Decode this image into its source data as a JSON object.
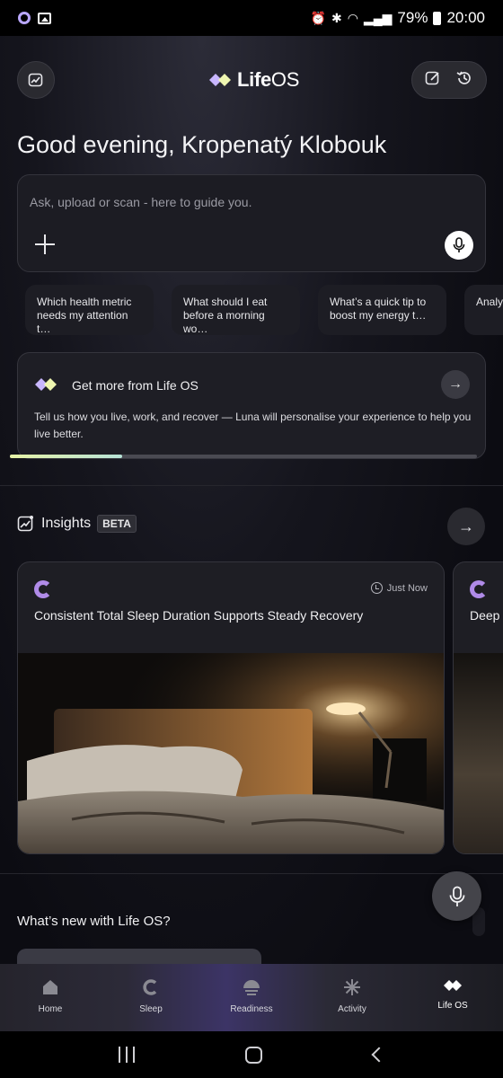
{
  "status_bar": {
    "battery": "79%",
    "time": "20:00"
  },
  "header": {
    "logo_bold": "Life",
    "logo_light": "OS"
  },
  "greeting": "Good evening, Kropenatý Klobouk",
  "ask": {
    "placeholder": "Ask, upload or scan - here to guide you."
  },
  "suggestions": [
    "Which health metric needs my attention t…",
    "What should I eat before a morning wo…",
    "What’s a quick tip to boost my energy t…",
    "Analy worko"
  ],
  "promo": {
    "title": "Get more from Life OS",
    "description": "Tell us how you live, work, and recover — Luna will personalise your experience to help you live better.",
    "progress": 0.24
  },
  "insights": {
    "title": "Insights",
    "badge": "BETA",
    "cards": [
      {
        "time": "Just Now",
        "title": "Consistent Total Sleep Duration Supports Steady Recovery"
      },
      {
        "time": "",
        "title": "Deep S"
      }
    ]
  },
  "whats_new": {
    "title": "What’s new with Life OS?"
  },
  "bottom_nav": [
    {
      "label": "Home",
      "icon": "home-icon"
    },
    {
      "label": "Sleep",
      "icon": "sleep-icon"
    },
    {
      "label": "Readiness",
      "icon": "readiness-icon"
    },
    {
      "label": "Activity",
      "icon": "activity-icon"
    },
    {
      "label": "Life OS",
      "icon": "lifeos-icon",
      "active": true
    }
  ],
  "colors": {
    "accent_purple": "#b08be8",
    "background": "#0c0c12",
    "progress_start": "#e6f2a6",
    "progress_end": "#b7e3d7"
  }
}
